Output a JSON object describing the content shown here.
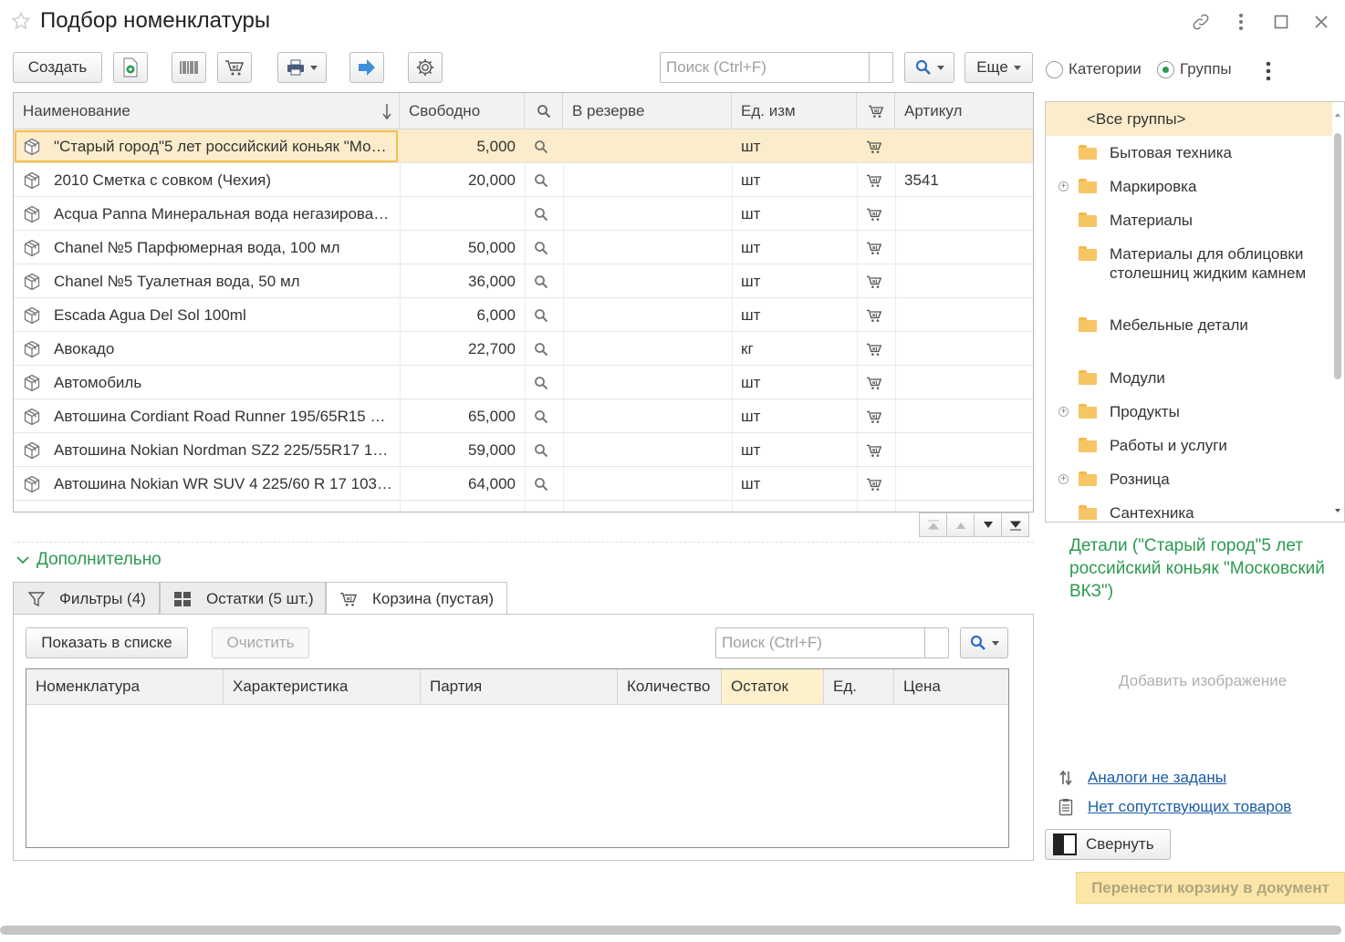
{
  "window": {
    "title": "Подбор номенклатуры"
  },
  "toolbar": {
    "create": "Создать",
    "search_placeholder": "Поиск (Ctrl+F)",
    "more": "Еще"
  },
  "view_mode": {
    "categories": "Категории",
    "groups": "Группы",
    "selected": "Группы"
  },
  "grid": {
    "columns": [
      "Наименование",
      "Свободно",
      "В резерве",
      "Ед. изм",
      "Артикул"
    ],
    "rows": [
      {
        "name": "\"Старый город\"5 лет российский коньяк \"Мо…",
        "free": "5,000",
        "reserve": "",
        "unit": "шт",
        "article": "",
        "selected": true
      },
      {
        "name": "2010 Сметка с совком (Чехия)",
        "free": "20,000",
        "reserve": "",
        "unit": "шт",
        "article": "3541"
      },
      {
        "name": "Acqua Panna Минеральная вода негазирова…",
        "free": "",
        "reserve": "",
        "unit": "шт",
        "article": ""
      },
      {
        "name": "Chanel №5 Парфюмерная вода, 100 мл",
        "free": "50,000",
        "reserve": "",
        "unit": "шт",
        "article": ""
      },
      {
        "name": "Chanel №5 Туалетная вода, 50 мл",
        "free": "36,000",
        "reserve": "",
        "unit": "шт",
        "article": ""
      },
      {
        "name": "Escada Agua Del Sol 100ml",
        "free": "6,000",
        "reserve": "",
        "unit": "шт",
        "article": ""
      },
      {
        "name": "Авокадо",
        "free": "22,700",
        "reserve": "",
        "unit": "кг",
        "article": ""
      },
      {
        "name": "Автомобиль",
        "free": "",
        "reserve": "",
        "unit": "шт",
        "article": ""
      },
      {
        "name": "Автошина Cordiant Road Runner 195/65R15 …",
        "free": "65,000",
        "reserve": "",
        "unit": "шт",
        "article": ""
      },
      {
        "name": "Автошина Nokian Nordman SZ2 225/55R17 1…",
        "free": "59,000",
        "reserve": "",
        "unit": "шт",
        "article": ""
      },
      {
        "name": "Автошина Nokian WR SUV 4 225/60 R 17 103…",
        "free": "64,000",
        "reserve": "",
        "unit": "шт",
        "article": ""
      }
    ]
  },
  "groups_tree": [
    {
      "label": "<Все группы>",
      "selected": true,
      "folder": false,
      "expandable": false
    },
    {
      "label": "Бытовая техника",
      "folder": true,
      "expandable": false
    },
    {
      "label": "Маркировка",
      "folder": true,
      "expandable": true
    },
    {
      "label": "Материалы",
      "folder": true,
      "expandable": false
    },
    {
      "label": "Материалы для облицовки столешниц жидким камнем",
      "folder": true,
      "expandable": false
    },
    {
      "label": "Мебельные детали",
      "folder": true,
      "expandable": false
    },
    {
      "label": "Модули",
      "folder": true,
      "expandable": false
    },
    {
      "label": "Продукты",
      "folder": true,
      "expandable": true
    },
    {
      "label": "Работы и услуги",
      "folder": true,
      "expandable": false
    },
    {
      "label": "Розница",
      "folder": true,
      "expandable": true
    },
    {
      "label": "Сантехника",
      "folder": true,
      "expandable": false
    }
  ],
  "additional": {
    "title": "Дополнительно",
    "tabs": [
      "Фильтры (4)",
      "Остатки (5 шт.)",
      "Корзина (пустая)"
    ],
    "active_tab": "Корзина (пустая)",
    "show_in_list": "Показать в списке",
    "clear": "Очистить",
    "search_placeholder": "Поиск (Ctrl+F)",
    "cart_columns": [
      "Номенклатура",
      "Характеристика",
      "Партия",
      "Количество",
      "Остаток",
      "Ед.",
      "Цена"
    ]
  },
  "details": {
    "title": "Детали (\"Старый город\"5 лет российский коньяк \"Московский ВКЗ\")",
    "add_image": "Добавить изображение",
    "analogs_link": "Аналоги не заданы",
    "related_link": "Нет сопутствующих товаров",
    "collapse": "Свернуть",
    "transfer": "Перенести корзину в документ"
  },
  "colors": {
    "accent_green": "#2c9a4e",
    "selection": "#fbeccb",
    "link": "#1a5ba6"
  }
}
